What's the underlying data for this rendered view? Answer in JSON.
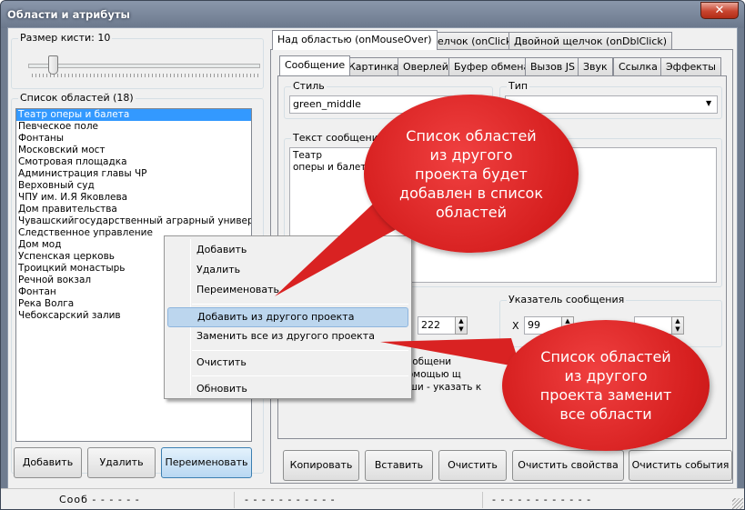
{
  "window": {
    "title": "Области и атрибуты",
    "close_label": "✕"
  },
  "brush": {
    "label": "Размер кисти:",
    "value": "10",
    "level": 0.1
  },
  "areas": {
    "label": "Список областей (18)",
    "items": [
      "Театр оперы и балета",
      "Певческое поле",
      "Фонтаны",
      "Московский мост",
      "Смотровая площадка",
      "Администрация главы ЧР",
      "Верховный суд",
      "ЧПУ им. И.Я Яковлева",
      "Дом правительства",
      "Чувашскийгосударственный аграрный университ",
      "Следственное управление",
      "Дом мод",
      "Успенская церковь",
      "Троицкий монастырь",
      "Речной вокзал",
      "Фонтан",
      "Река Волга",
      "Чебоксарский залив"
    ],
    "selected_index": 0
  },
  "left_buttons": {
    "add": "Добавить",
    "delete": "Удалить",
    "rename": "Переименовать"
  },
  "event_tabs": [
    "Над областью (onMouseOver)",
    "Щелчок (onClick)",
    "Двойной щелчок (onDblClick)"
  ],
  "prop_tabs": [
    "Сообщение",
    "Картинка",
    "Оверлей",
    "Буфер обмена",
    "Вызов JS",
    "Звук",
    "Ссылка",
    "Эффекты"
  ],
  "style": {
    "label": "Стиль",
    "value": "green_middle"
  },
  "type": {
    "label": "Тип",
    "value": ""
  },
  "message_text": {
    "label": "Текст сообщения",
    "line1": "Театр",
    "line2": "оперы и балета"
  },
  "size_field": {
    "value": "222"
  },
  "pointer": {
    "label": "Указатель сообщения",
    "x_label": "X",
    "x_value": "99",
    "y_value": ""
  },
  "hidden_text": {
    "line1": "сообщени",
    "line2": "помощью щ",
    "line3": "ыши - указать к"
  },
  "bottom_buttons": {
    "copy": "Копировать",
    "paste": "Вставить",
    "clear": "Очистить",
    "clear_props": "Очистить свойства",
    "clear_events": "Очистить события"
  },
  "context_menu": {
    "add": "Добавить",
    "delete": "Удалить",
    "rename": "Переименовать",
    "add_from_project": "Добавить из другого проекта",
    "replace_from_project": "Заменить все из другого проекта",
    "clear": "Очистить",
    "refresh": "Обновить"
  },
  "callouts": {
    "top": "Список областей из другого проекта будет добавлен в список областей",
    "bottom": "Список областей из другого проекта заменит все области"
  },
  "status": {
    "pane1": "Сооб  -  -  -  -  -  -",
    "pane2": "-  -  -  -  -  -  -  -  -  -  -",
    "pane3": "-  -  -  -  -  -  -  -  -  -  -  -"
  },
  "colors": {
    "accent": "#3399ff",
    "callout": "#e02828",
    "menu_highlight": "#bcd6ee"
  }
}
